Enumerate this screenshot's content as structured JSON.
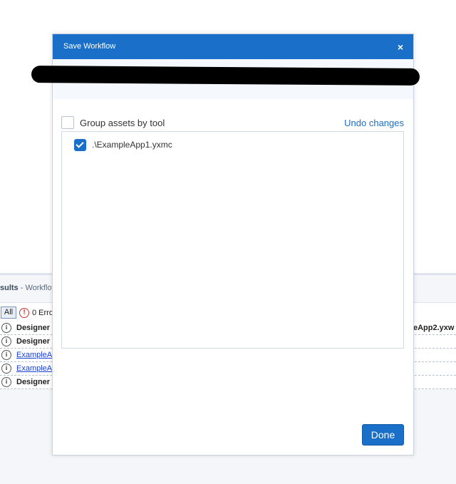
{
  "background": {
    "results_title": "sults",
    "results_subtitle": " - Workflow",
    "all_label": "All",
    "errors_label": "0 Erro",
    "rows": [
      {
        "text": "Designer",
        "link": false,
        "right": "eApp2.yxw"
      },
      {
        "text": "Designer",
        "link": false,
        "right": ""
      },
      {
        "text": "ExampleA",
        "link": true,
        "right": ""
      },
      {
        "text": "ExampleA",
        "link": true,
        "right": ""
      },
      {
        "text": "Designer",
        "link": false,
        "right": ""
      }
    ]
  },
  "modal": {
    "title": "Save Workflow",
    "close_symbol": "×",
    "group_label": "Group assets by tool",
    "undo_label": "Undo changes",
    "assets": [
      {
        "label": ".\\ExampleApp1.yxmc",
        "checked": true
      }
    ],
    "done_label": "Done"
  },
  "colors": {
    "accent": "#1a6fc9",
    "header_bg": "#1a6fc9",
    "error": "#d23333"
  }
}
